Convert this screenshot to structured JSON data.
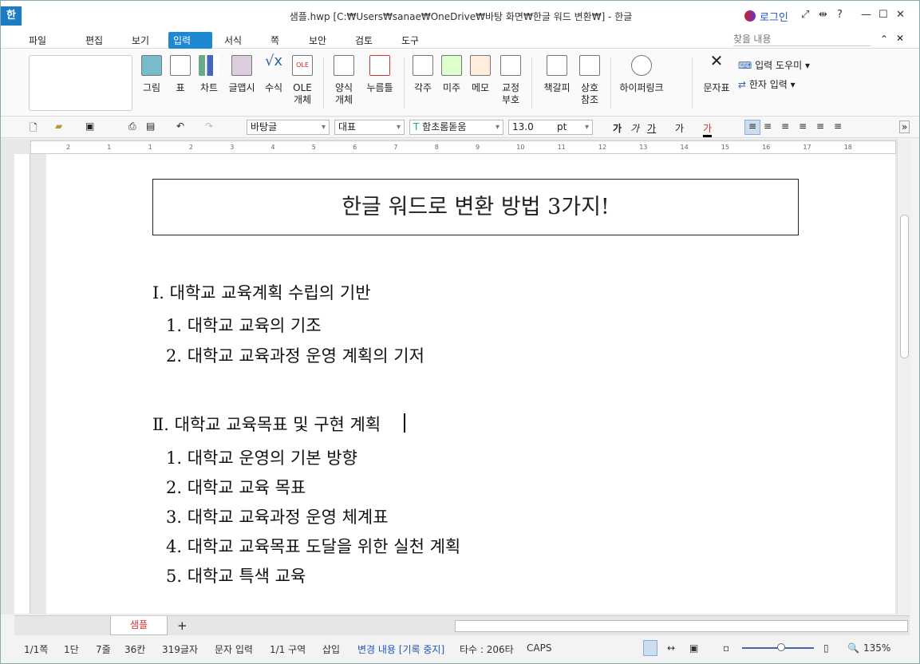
{
  "window": {
    "title": "샘플.hwp [C:₩Users₩sanae₩OneDrive₩바탕 화면₩한글 워드 변환₩] - 한글",
    "logo": "한",
    "login": "로그인",
    "help": "?",
    "controls": [
      "—",
      "☐",
      "✕"
    ]
  },
  "menu": {
    "items": [
      "파일",
      "편집",
      "보기",
      "입력",
      "서식",
      "쪽",
      "보안",
      "검토",
      "도구"
    ],
    "active": "입력",
    "search_placeholder": "찾을 내용"
  },
  "ribbon": {
    "buttons": [
      "그림",
      "표",
      "차트",
      "글맵시",
      "수식",
      "OLE 개체",
      "양식 개체",
      "누름틀",
      "각주",
      "미주",
      "메모",
      "교정 부호",
      "책갈피",
      "상호 참조",
      "하이퍼링크",
      "문자표"
    ],
    "side": [
      "입력 도우미",
      "한자 입력"
    ]
  },
  "toolbar": {
    "style": "바탕글",
    "lang": "대표",
    "font": "함초롬돋움",
    "size": "13.0",
    "unit": "pt"
  },
  "ruler": {
    "ticks": [
      "2",
      "1",
      "1",
      "2",
      "3",
      "4",
      "5",
      "6",
      "7",
      "8",
      "9",
      "10",
      "11",
      "12",
      "13",
      "14",
      "15",
      "16",
      "17",
      "18"
    ]
  },
  "document": {
    "title": "한글 워드로 변환 방법 3가지!",
    "sections": [
      {
        "heading": "Ⅰ. 대학교 교육계획 수립의 기반",
        "items": [
          "1. 대학교 교육의 기조",
          "2. 대학교 교육과정 운영 계획의 기저"
        ]
      },
      {
        "heading": "Ⅱ. 대학교 교육목표 및 구현 계획",
        "items": [
          "1. 대학교 운영의 기본 방향",
          "2. 대학교 교육 목표",
          "3. 대학교 교육과정 운영 체계표",
          "4. 대학교 교육목표 도달을 위한 실천 계획",
          "5. 대학교 특색 교육"
        ]
      }
    ]
  },
  "tabs": {
    "active": "샘플",
    "add": "+"
  },
  "status": {
    "page": "1/1쪽",
    "col": "1단",
    "line": "7줄",
    "pos": "36칸",
    "chars": "319글자",
    "mode": "문자 입력",
    "section": "1/1 구역",
    "insert": "삽입",
    "track": "변경 내용 [기록 중지]",
    "keys": "타수 : 206타",
    "caps": "CAPS",
    "zoom": "135%"
  },
  "colors": {
    "accent": "#1e88d2",
    "tab_text": "#d03030",
    "track": "#2255bb"
  }
}
